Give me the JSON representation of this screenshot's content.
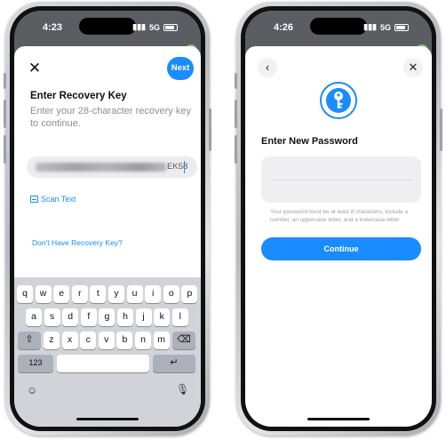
{
  "left_screen": {
    "status": {
      "time": "4:23",
      "network": "5G"
    },
    "header": {
      "close_icon": "close-icon",
      "next_label": "Next"
    },
    "title": "Enter Recovery Key",
    "description": "Enter your 28-character recovery key to continue.",
    "key_field": {
      "visible_suffix": "EK58"
    },
    "scan_text_label": "Scan Text",
    "dont_have_key_label": "Don't Have Recovery Key?",
    "keyboard": {
      "row1": [
        "q",
        "w",
        "e",
        "r",
        "t",
        "y",
        "u",
        "i",
        "o",
        "p"
      ],
      "row2": [
        "a",
        "s",
        "d",
        "f",
        "g",
        "h",
        "j",
        "k",
        "l"
      ],
      "row3": [
        "z",
        "x",
        "c",
        "v",
        "b",
        "n",
        "m"
      ],
      "numbers_key": "123",
      "shift_icon": "shift-icon",
      "delete_icon": "delete-icon",
      "return_icon": "return-icon",
      "emoji_icon": "emoji-icon",
      "mic_icon": "microphone-icon"
    }
  },
  "right_screen": {
    "status": {
      "time": "4:26",
      "network": "5G"
    },
    "header": {
      "back_icon": "chevron-left-icon",
      "close_icon": "close-icon"
    },
    "badge_icon": "key-icon",
    "title": "Enter New Password",
    "hint": "Your password must be at least 8 characters, include a number, an uppercase letter, and a lowercase letter.",
    "continue_label": "Continue"
  },
  "colors": {
    "accent": "#1a8cff",
    "keyboard_bg": "#d1d3d9",
    "muted_text": "#8e8e93"
  }
}
